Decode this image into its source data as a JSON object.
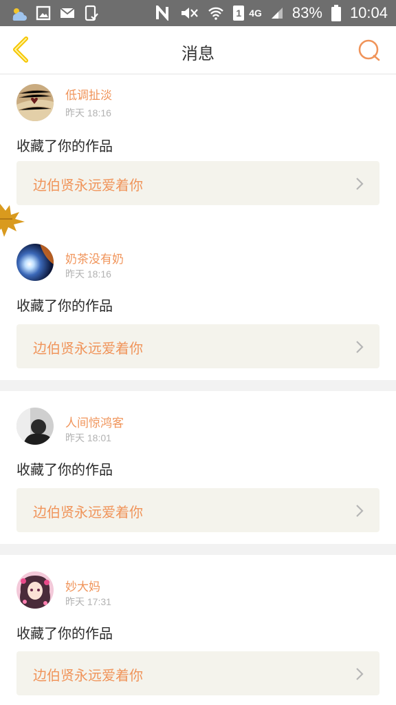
{
  "status_bar": {
    "battery_percent": "83%",
    "time": "10:04",
    "network_type": "4G",
    "sim_slot": "1",
    "icons": [
      "weather-icon",
      "gallery-icon",
      "mail-icon",
      "phone-check-icon",
      "nfc-icon",
      "mute-icon",
      "wifi-icon",
      "sim-icon",
      "signal-icon",
      "battery-icon"
    ]
  },
  "header": {
    "title": "消息",
    "back_icon": "chevron-left-icon",
    "right_icon": "chat-bubble-icon"
  },
  "colors": {
    "accent": "#f0945a",
    "nav_icon_yellow": "#f5c400",
    "card_box": "#f4f3ec",
    "page_bg": "#f2f2f2"
  },
  "messages": [
    {
      "username": "低调扯淡",
      "time": "昨天 18:16",
      "action": "收藏了你的作品",
      "work_title": "边伯贤永远爱着你",
      "avatar": "book-pages"
    },
    {
      "username": "奶茶没有奶",
      "time": "昨天 18:16",
      "action": "收藏了你的作品",
      "work_title": "边伯贤永远爱着你",
      "avatar": "light-burst"
    },
    {
      "username": "人间惊鸿客",
      "time": "昨天 18:01",
      "action": "收藏了你的作品",
      "work_title": "边伯贤永远爱着你",
      "avatar": "dark-portrait"
    },
    {
      "username": "妙大妈",
      "time": "昨天 17:31",
      "action": "收藏了你的作品",
      "work_title": "边伯贤永远爱着你",
      "avatar": "anime-girl"
    }
  ]
}
